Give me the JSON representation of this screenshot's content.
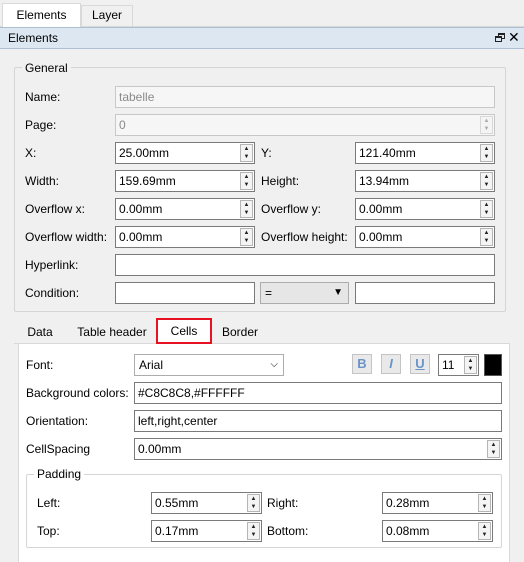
{
  "top_tabs": [
    "Elements",
    "Layer"
  ],
  "panel": {
    "title": "Elements"
  },
  "general": {
    "title": "General",
    "name_label": "Name:",
    "name_value": "tabelle",
    "page_label": "Page:",
    "page_value": "0",
    "x_label": "X:",
    "x_value": "25.00mm",
    "y_label": "Y:",
    "y_value": "121.40mm",
    "width_label": "Width:",
    "width_value": "159.69mm",
    "height_label": "Height:",
    "height_value": "13.94mm",
    "overflow_x_label": "Overflow x:",
    "overflow_x_value": "0.00mm",
    "overflow_y_label": "Overflow y:",
    "overflow_y_value": "0.00mm",
    "overflow_width_label": "Overflow width:",
    "overflow_width_value": "0.00mm",
    "overflow_height_label": "Overflow height:",
    "overflow_height_value": "0.00mm",
    "hyperlink_label": "Hyperlink:",
    "hyperlink_value": "",
    "condition_label": "Condition:",
    "condition_left": "",
    "condition_op": "=",
    "condition_right": ""
  },
  "sub_tabs": [
    "Data",
    "Table header",
    "Cells",
    "Border"
  ],
  "active_sub_tab": "Cells",
  "cells": {
    "font_label": "Font:",
    "font_value": "Arial",
    "bold_glyph": "B",
    "italic_glyph": "I",
    "underline_glyph": "U",
    "font_size": "11",
    "font_color": "#000000",
    "bg_label": "Background colors:",
    "bg_value": "#C8C8C8,#FFFFFF",
    "orientation_label": "Orientation:",
    "orientation_value": "left,right,center",
    "cellspacing_label": "CellSpacing",
    "cellspacing_value": "0.00mm",
    "padding": {
      "title": "Padding",
      "left_label": "Left:",
      "left_value": "0.55mm",
      "right_label": "Right:",
      "right_value": "0.28mm",
      "top_label": "Top:",
      "top_value": "0.17mm",
      "bottom_label": "Bottom:",
      "bottom_value": "0.08mm"
    }
  },
  "colors": {
    "highlight": "#e81123",
    "header_bg": "#dde7f2"
  }
}
